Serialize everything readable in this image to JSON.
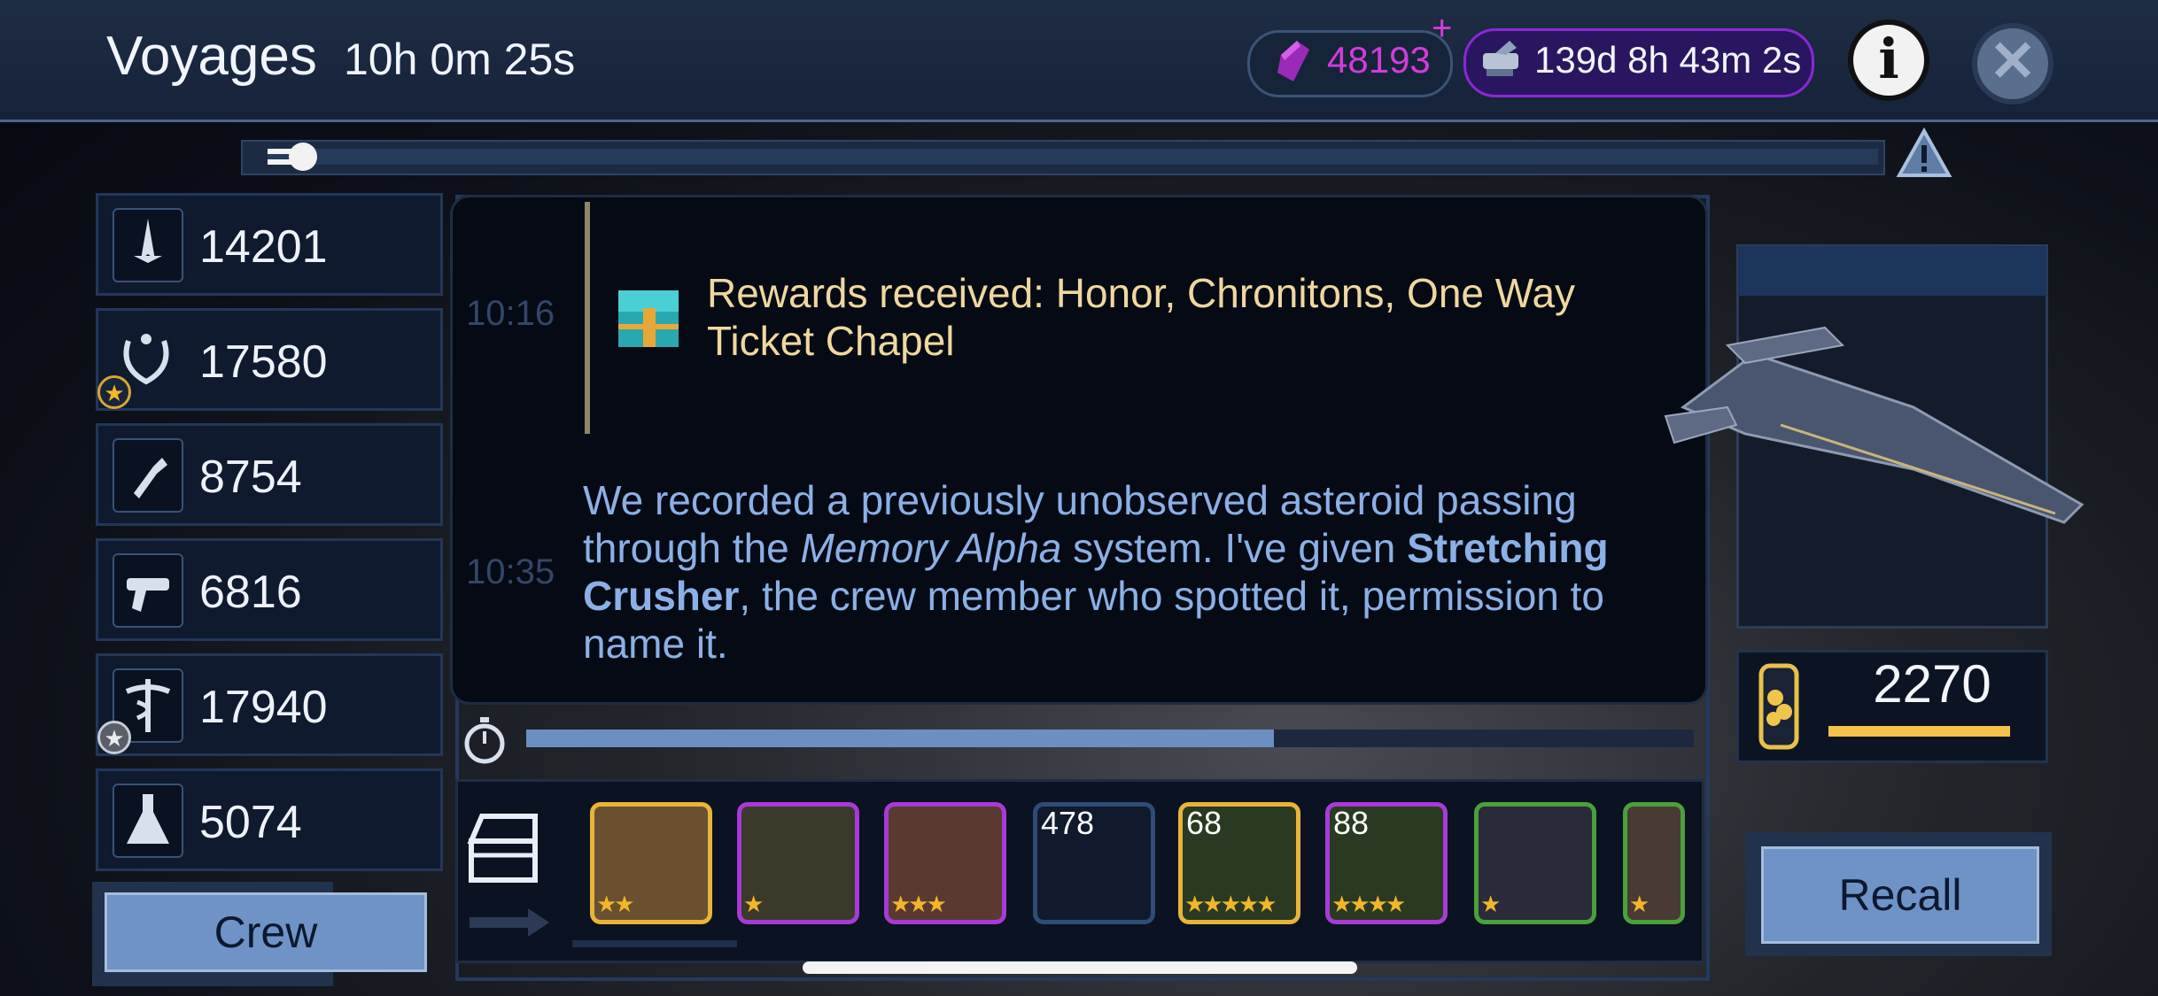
{
  "header": {
    "title": "Voyages",
    "voyage_timer": "10h 0m 25s",
    "dilithium": "48193",
    "plus_symbol": "+",
    "event_timer": "139d 8h 43m 2s",
    "info_glyph": "i",
    "close_glyph": "✕"
  },
  "skills": [
    {
      "icon": "command-icon",
      "value": "14201"
    },
    {
      "icon": "diplomacy-icon",
      "value": "17580"
    },
    {
      "icon": "engineering-icon",
      "value": "8754"
    },
    {
      "icon": "security-icon",
      "value": "6816"
    },
    {
      "icon": "medicine-icon",
      "value": "17940"
    },
    {
      "icon": "science-icon",
      "value": "5074"
    }
  ],
  "crew_button": "Crew",
  "log": {
    "entries": [
      {
        "time": "10:16",
        "text": "Rewards received: Honor, Chronitons, One Way Ticket Chapel"
      },
      {
        "time": "10:35",
        "text_1": "We recorded a previously unobserved asteroid passing through the ",
        "italic": "Memory Alpha",
        "text_2": " system. I've given ",
        "bold": "Stretching Crusher",
        "text_3": ", the crew member who spotted it, permission to name it."
      }
    ]
  },
  "voyage_progress": 0.64,
  "rewards": [
    {
      "name": "crew-blonde",
      "count": "",
      "stars": "★★",
      "border": "#e8b43a",
      "bg": "#6a5030"
    },
    {
      "name": "crew-redhair",
      "count": "",
      "stars": "★",
      "border": "#a83ad8",
      "bg": "#3b3a2a"
    },
    {
      "name": "crew-curly",
      "count": "",
      "stars": "★★★",
      "border": "#a83ad8",
      "bg": "#5a3a30"
    },
    {
      "name": "honor-icon",
      "count": "478",
      "stars": "",
      "border": "#2f4c78",
      "bg": "#111a2c"
    },
    {
      "name": "schematic-gold",
      "count": "68",
      "stars": "★★★★★",
      "border": "#e8b43a",
      "bg": "#2a3a22"
    },
    {
      "name": "schematic-purple",
      "count": "88",
      "stars": "★★★★",
      "border": "#a83ad8",
      "bg": "#2a3a22"
    },
    {
      "name": "crew-romulan",
      "count": "",
      "stars": "★",
      "border": "#4aa03a",
      "bg": "#2a2a3a"
    },
    {
      "name": "crew-partial",
      "count": "",
      "stars": "★",
      "border": "#4aa03a",
      "bg": "#4a3a34"
    }
  ],
  "antimatter": "2270",
  "antimatter_fraction": 0.95,
  "recall_button": "Recall",
  "colors": {
    "accent": "#6f93c6",
    "dilithium": "#d43bdc",
    "reward_text": "#efd7a0",
    "event_text": "#8bb0e6"
  }
}
